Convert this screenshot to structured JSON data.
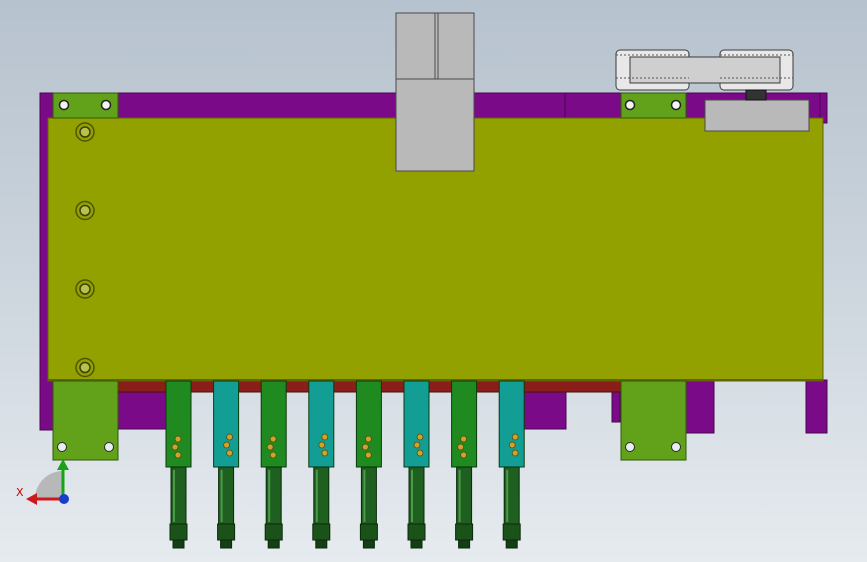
{
  "viewport": {
    "background_top": "#b6c2ce",
    "background_bottom": "#e6ebef"
  },
  "colors": {
    "frame": "#7a0a87",
    "frame_dark": "#4b0552",
    "plate": "#93a100",
    "plate_edge": "#5d6600",
    "bracket": "#62a11a",
    "cylinder": "#b9b9b9",
    "cylinder_edge": "#4a4a4a",
    "finger_green": "#1f8a1f",
    "finger_teal": "#129e95",
    "hole": "#c9a52c",
    "rod": "#1f5f1f",
    "rail": "#8a1f1a",
    "belt": "#cfcfcf"
  },
  "assembly": {
    "plate_holes": 4,
    "finger_colors": [
      "green",
      "teal",
      "green",
      "teal",
      "green",
      "teal",
      "green",
      "teal"
    ],
    "finger_count": 8
  },
  "triad": {
    "x_axis_label": "X"
  }
}
